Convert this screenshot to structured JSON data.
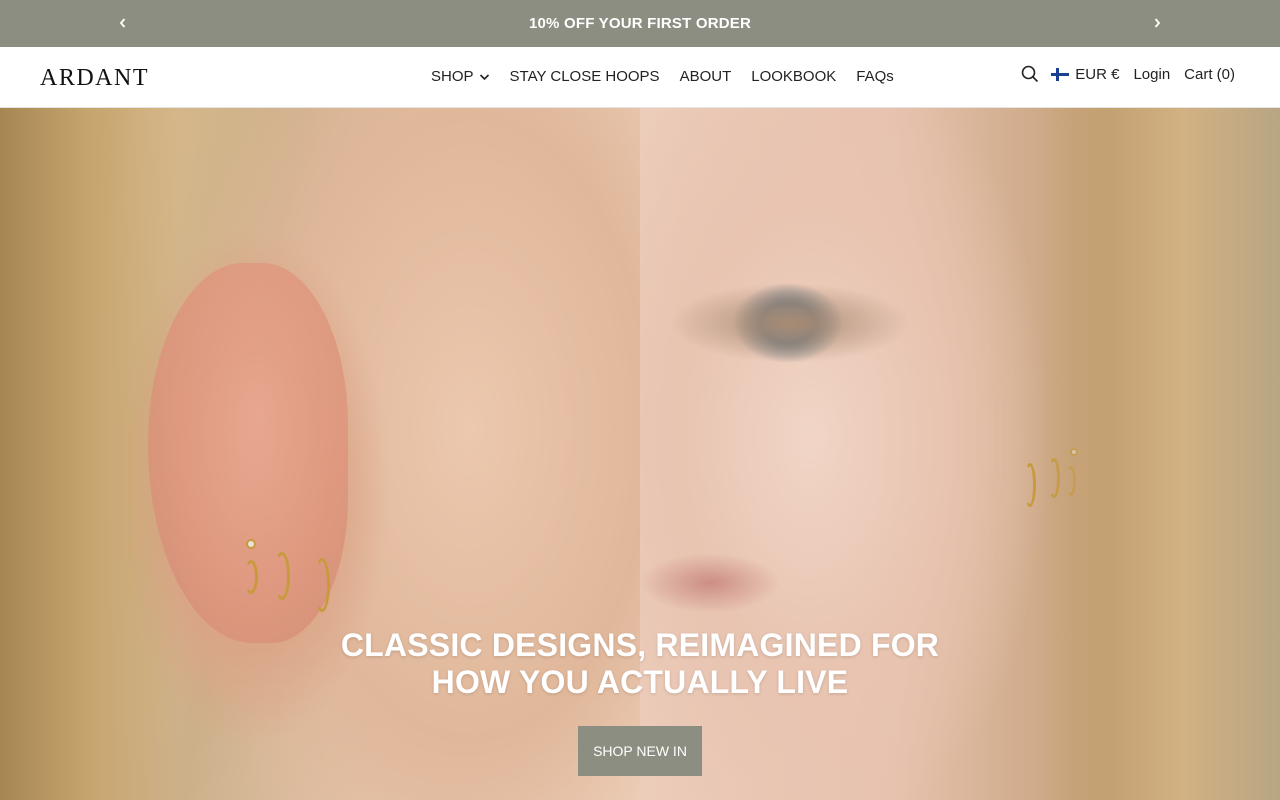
{
  "announcement": {
    "text": "10% OFF YOUR FIRST ORDER",
    "prev_icon": "chevron-left-icon",
    "next_icon": "chevron-right-icon"
  },
  "header": {
    "logo": "ARDANT",
    "nav": [
      {
        "label": "SHOP",
        "has_dropdown": true
      },
      {
        "label": "STAY CLOSE HOOPS"
      },
      {
        "label": "ABOUT"
      },
      {
        "label": "LOOKBOOK"
      },
      {
        "label": "FAQs"
      }
    ],
    "search_icon": "search-icon",
    "currency": {
      "flag": "finland-flag-icon",
      "label": "EUR €"
    },
    "login_label": "Login",
    "cart_label": "Cart (0)"
  },
  "hero": {
    "title_line1": "CLASSIC DESIGNS, REIMAGINED FOR",
    "title_line2": "HOW YOU ACTUALLY LIVE",
    "cta_label": "SHOP NEW IN"
  },
  "colors": {
    "announcement_bg": "#8b8e80",
    "cta_bg": "#8b8e80",
    "text": "#222222"
  }
}
